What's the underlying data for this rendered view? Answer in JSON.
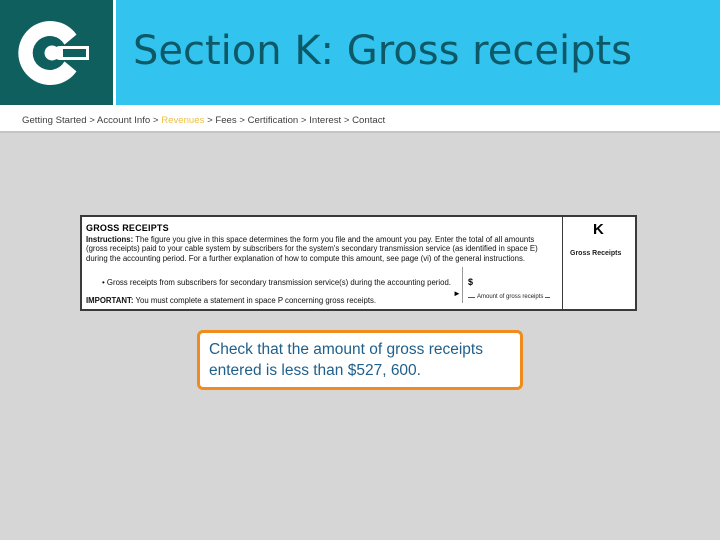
{
  "header": {
    "title": "Section K: Gross receipts"
  },
  "breadcrumb": {
    "before": "Getting Started > Account Info > ",
    "active": "Revenues",
    "after": " > Fees > Certification > Interest > Contact"
  },
  "form": {
    "heading": "GROSS RECEIPTS",
    "instructions_label": "Instructions:",
    "instructions_text": " The figure you give in this space determines the form you file and the amount you pay. Enter the total of all amounts (gross receipts) paid to your cable system by subscribers for the system's secondary transmission service (as identified in space E) during the accounting period. For a further explanation of how to compute this amount, see page (vi) of the general instructions.",
    "bullet_text": "Gross receipts from subscribers for secondary transmission service(s) during the accounting period.",
    "important_label": "IMPORTANT:",
    "important_text": " You must complete a statement in space P concerning gross receipts.",
    "dollar": "$",
    "amount_label": "Amount of gross receipts",
    "space_letter": "K",
    "space_name": "Gross Receipts"
  },
  "callout": {
    "text": "Check that the amount of gross receipts entered is less than $527, 600."
  },
  "colors": {
    "logo_bg": "#0f5f5f",
    "title_bar": "#33c3ef",
    "title_text": "#0d5968",
    "crumb_active": "#f0c040",
    "callout_border": "#f08c1e",
    "callout_text": "#1f5f8a"
  }
}
